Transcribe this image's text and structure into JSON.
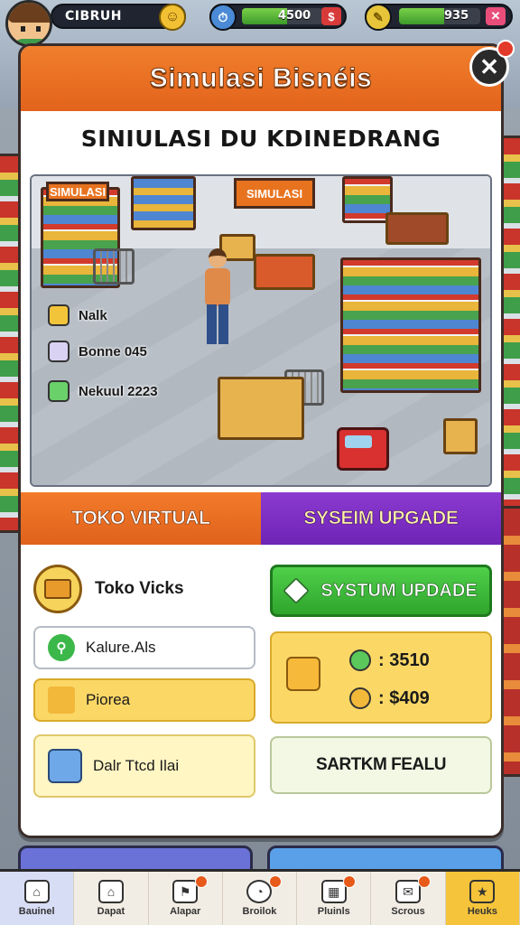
{
  "hud": {
    "player_name": "CIBRUH",
    "energy": {
      "text": "4500",
      "fill": 0.55
    },
    "coins": {
      "text": "935",
      "fill": 0.55
    }
  },
  "panel": {
    "title": "Simulasi Bisnéis",
    "subtitle": "SINIULASI DU KDINEDRANG",
    "scene": {
      "signs": [
        "SIMULASI",
        "SIMULASI"
      ],
      "legend": [
        {
          "icon": "box-icon",
          "label": "Nalk"
        },
        {
          "icon": "robot-icon",
          "label": "Bonne 045"
        },
        {
          "icon": "trash-icon",
          "label": "Nekuul 2223"
        }
      ]
    },
    "tabs": {
      "left": "TOKO VIRTUAL",
      "right": "SYSEIM UPGADE"
    },
    "store": {
      "name": "Toko Vicks",
      "fields": [
        {
          "icon": "leaf-icon",
          "label": "Kalure.Als"
        },
        {
          "icon": "cheese-icon",
          "label": "Piorea"
        },
        {
          "icon": "basket-icon",
          "label": "Dalr Ttcd Ilai"
        }
      ]
    },
    "upgrade": {
      "button_label": "SYSTUM UPDADE",
      "costs": [
        {
          "icon": "gear-icon",
          "value": ": 3510"
        },
        {
          "icon": "moneybag-icon",
          "value": ": $409"
        }
      ],
      "start_label": "SARTKM FEALU"
    }
  },
  "nav": [
    {
      "icon": "home-icon",
      "label": "Bauinel",
      "badge": false
    },
    {
      "icon": "house-icon",
      "label": "Dapat",
      "badge": false
    },
    {
      "icon": "flag-icon",
      "label": "Alapar",
      "badge": true
    },
    {
      "icon": "clock-icon",
      "label": "Broilok",
      "badge": true
    },
    {
      "icon": "calendar-icon",
      "label": "Pluinls",
      "badge": true
    },
    {
      "icon": "mail-icon",
      "label": "Scrous",
      "badge": true
    },
    {
      "icon": "star-icon",
      "label": "Heuks",
      "badge": false
    }
  ],
  "colors": {
    "header_orange": "#e8681e",
    "tab_purple": "#7a2ac2",
    "upgrade_green": "#3cb83a",
    "cost_yellow": "#fbd866"
  }
}
